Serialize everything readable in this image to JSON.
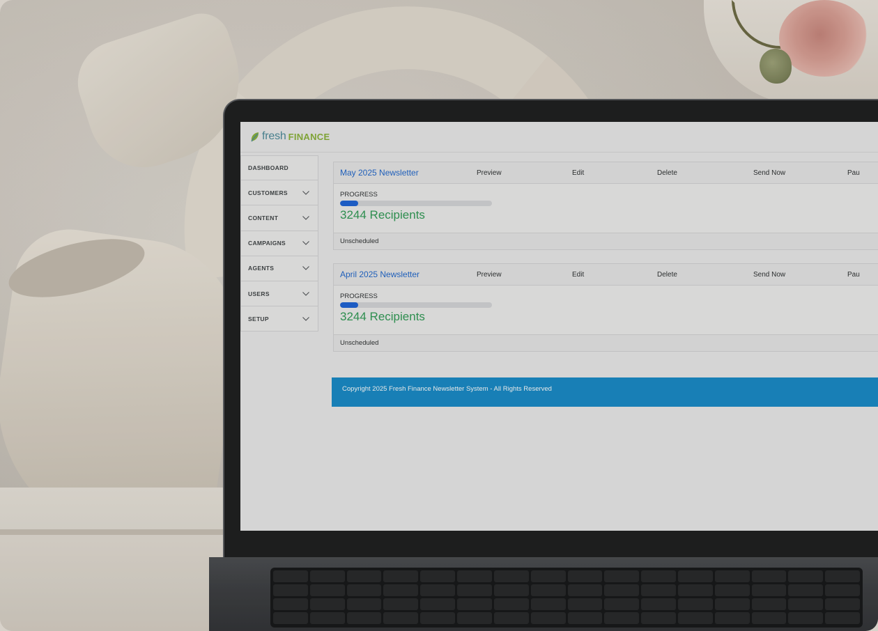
{
  "brand": {
    "logo_part1": "fresh",
    "logo_part2": "FINANCE",
    "colors": {
      "fresh": "#4b8a9a",
      "finance": "#8ab23a",
      "accent": "#1f66cc",
      "footer": "#178ac8",
      "recipients": "#2f9a55"
    }
  },
  "sidebar": {
    "items": [
      {
        "label": "DASHBOARD",
        "expandable": false
      },
      {
        "label": "CUSTOMERS",
        "expandable": true
      },
      {
        "label": "CONTENT",
        "expandable": true
      },
      {
        "label": "CAMPAIGNS",
        "expandable": true
      },
      {
        "label": "AGENTS",
        "expandable": true
      },
      {
        "label": "USERS",
        "expandable": true
      },
      {
        "label": "SETUP",
        "expandable": true
      }
    ]
  },
  "newsletters": [
    {
      "title": "May 2025 Newsletter",
      "actions": {
        "preview": "Preview",
        "edit": "Edit",
        "delete": "Delete",
        "send": "Send Now",
        "pause": "Pau"
      },
      "progress_label": "PROGRESS",
      "progress": 0.12,
      "recipients": "3244 Recipients",
      "schedule": "Unscheduled"
    },
    {
      "title": "April 2025 Newsletter",
      "actions": {
        "preview": "Preview",
        "edit": "Edit",
        "delete": "Delete",
        "send": "Send Now",
        "pause": "Pau"
      },
      "progress_label": "PROGRESS",
      "progress": 0.12,
      "recipients": "3244 Recipients",
      "schedule": "Unscheduled"
    }
  ],
  "footer": {
    "text": "Copyright 2025 Fresh Finance Newsletter System - All Rights Reserved"
  },
  "icons": {
    "logo": "leaf-icon",
    "expand": "chevron-down-icon"
  }
}
